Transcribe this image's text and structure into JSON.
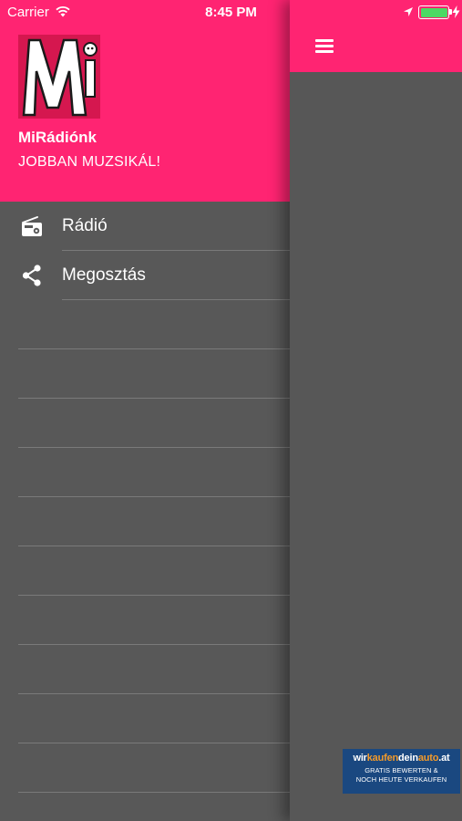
{
  "status_bar": {
    "carrier": "Carrier",
    "time": "8:45 PM",
    "battery_level": 1.0,
    "battery_color": "#4cd964"
  },
  "drawer": {
    "header_color": "#ff2472",
    "app_name": "MiRádiónk",
    "tagline": "JOBBAN MUZSIKÁL!",
    "items": [
      {
        "label": "Rádió",
        "icon": "radio-icon"
      },
      {
        "label": "Megosztás",
        "icon": "share-icon"
      }
    ]
  },
  "main": {
    "menu_icon": "hamburger-menu-icon"
  },
  "ad": {
    "title_part1": "wir",
    "title_part2": "kaufen",
    "title_part3": "dein",
    "title_part4": "auto",
    "title_part5": ".at",
    "line1": "GRATIS BEWERTEN &",
    "line2": "NOCH HEUTE VERKAUFEN",
    "background": "#1a4880",
    "accent": "#f39a2a"
  }
}
